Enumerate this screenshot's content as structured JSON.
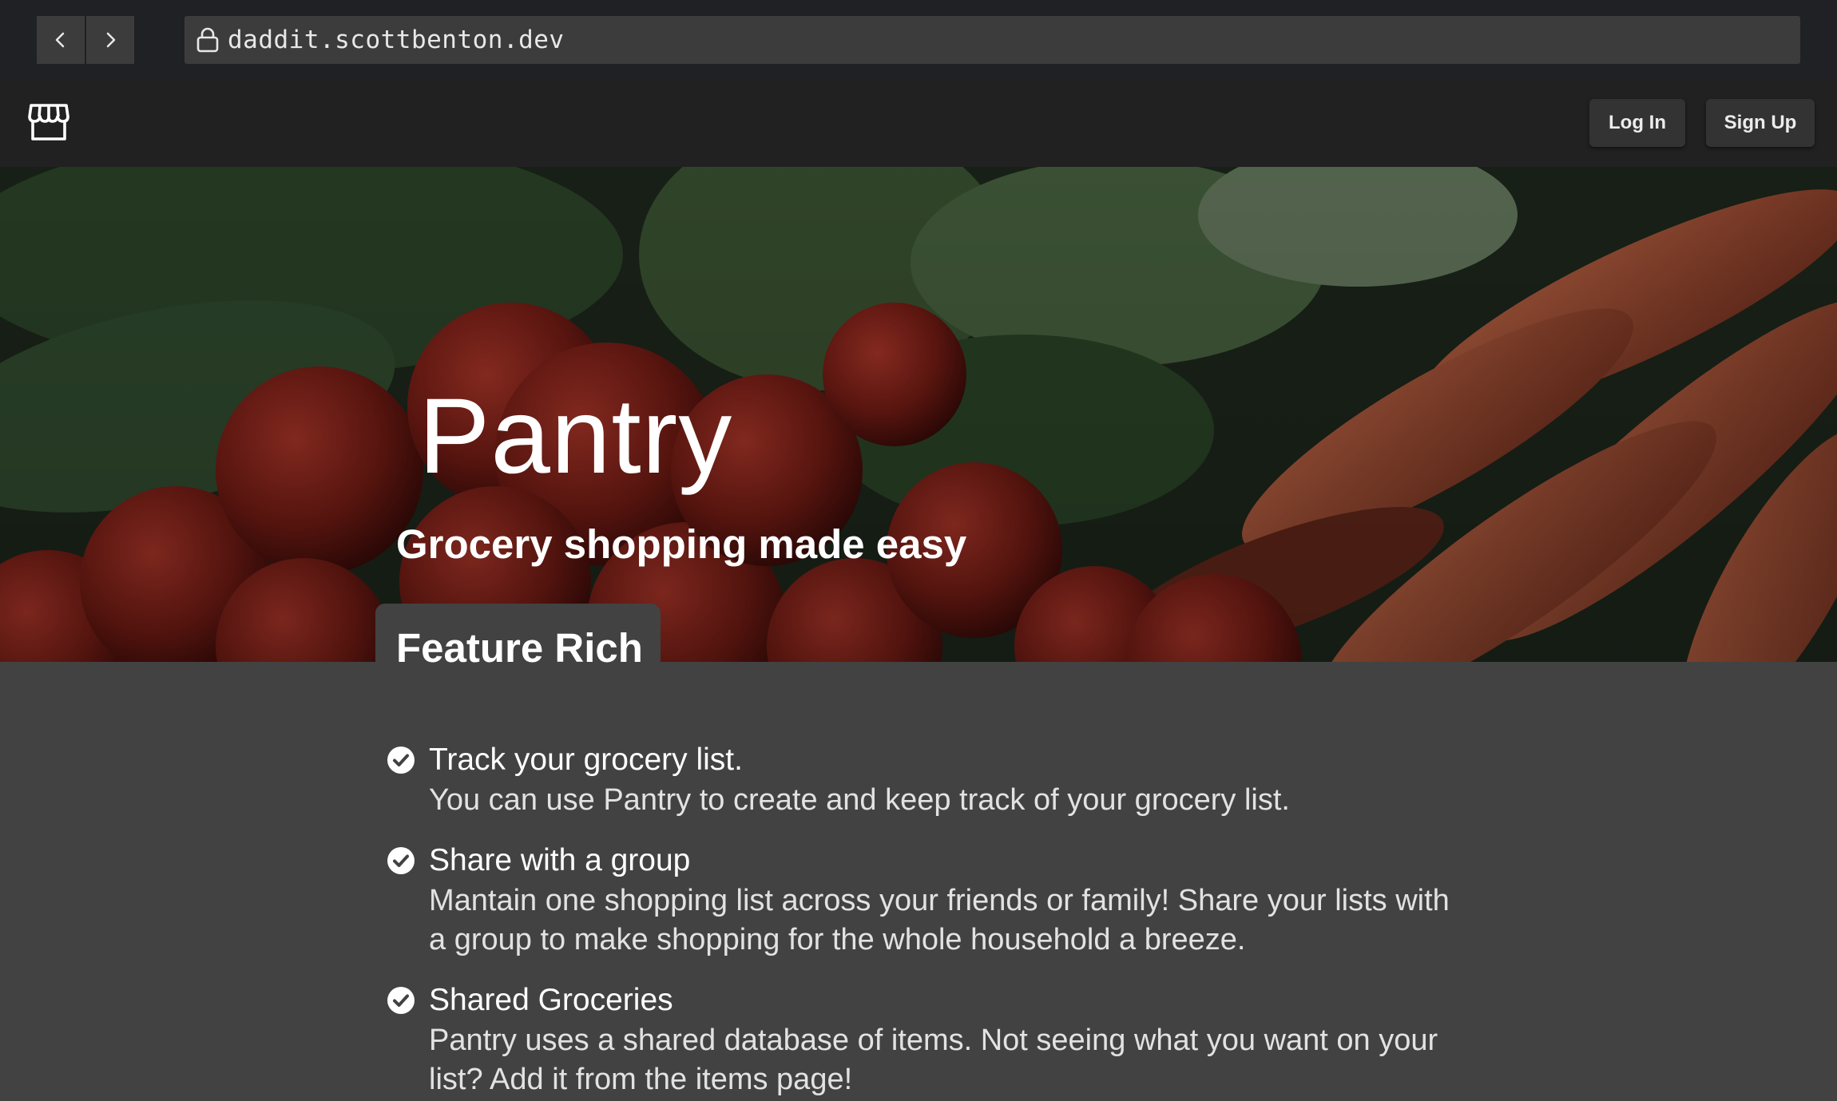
{
  "browser": {
    "url": "daddit.scottbenton.dev"
  },
  "header": {
    "login_label": "Log In",
    "signup_label": "Sign Up"
  },
  "hero": {
    "title": "Pantry",
    "subtitle": "Grocery shopping made easy"
  },
  "features": {
    "section_title": "Feature Rich",
    "items": [
      {
        "title": "Track your grocery list.",
        "description": "You can use Pantry to create and keep track of your grocery list."
      },
      {
        "title": "Share with a group",
        "description": "Mantain one shopping list across your friends or family! Share your lists with a group to make shopping for the whole household a breeze."
      },
      {
        "title": "Shared Groceries",
        "description": "Pantry uses a shared database of items. Not seeing what you want on your list? Add it from the items page!"
      }
    ]
  },
  "colors": {
    "browser_chrome": "#202124",
    "app_bar": "#212121",
    "content_bg": "#424242",
    "text": "#ffffff"
  }
}
